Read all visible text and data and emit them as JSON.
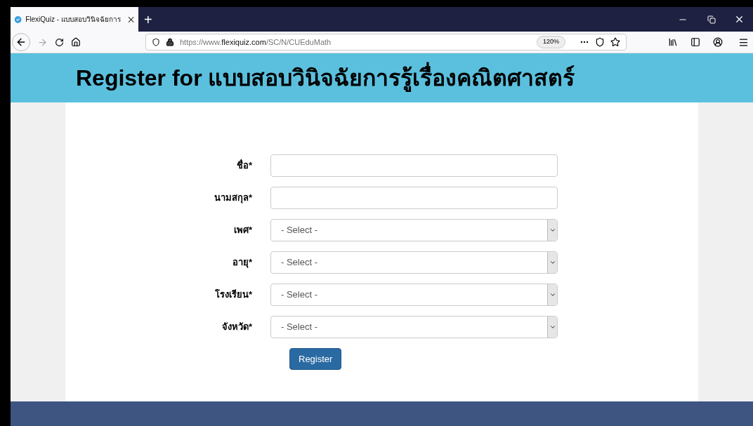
{
  "browser": {
    "tab": {
      "title": "FlexiQuiz - แบบสอบวินิจฉัยการ",
      "selected": true
    },
    "new_tab": "+",
    "url": {
      "host": "https://www.",
      "domain": "flexiquiz.com",
      "path": "/SC/N/CUEduMath"
    },
    "zoom": "120%"
  },
  "page": {
    "title": "Register for แบบสอบวินิจฉัยการรู้เรื่องคณิตศาสตร์",
    "fields": [
      {
        "kind": "text",
        "label": "ชื่อ*"
      },
      {
        "kind": "text",
        "label": "นามสกุล*"
      },
      {
        "kind": "select",
        "label": "เพศ*",
        "value": "- Select -"
      },
      {
        "kind": "select",
        "label": "อายุ*",
        "value": "- Select -"
      },
      {
        "kind": "select",
        "label": "โรงเรียน*",
        "value": "- Select -"
      },
      {
        "kind": "select",
        "label": "จังหวัด*",
        "value": "- Select -"
      }
    ],
    "submit": "Register"
  }
}
